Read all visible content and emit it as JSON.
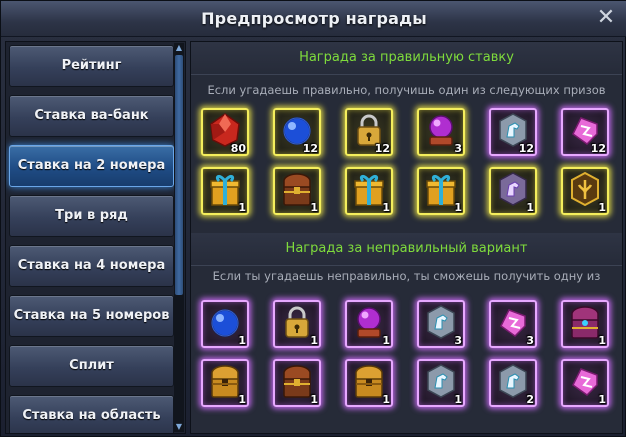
{
  "window": {
    "title": "Предпросмотр награды"
  },
  "sidebar": {
    "tabs": [
      {
        "label": "Рейтинг",
        "active": false
      },
      {
        "label": "Ставка ва-банк",
        "active": false
      },
      {
        "label": "Ставка на 2 номера",
        "active": true
      },
      {
        "label": "Три в ряд",
        "active": false
      },
      {
        "label": "Ставка на 4 номера",
        "active": false
      },
      {
        "label": "Ставка на 5 номеров",
        "active": false
      },
      {
        "label": "Сплит",
        "active": false
      },
      {
        "label": "Ставка на область",
        "active": false
      }
    ]
  },
  "correct": {
    "header": "Награда за правильную ставку",
    "description": "Если угадаешь правильно, получишь один из следующих призов",
    "items": [
      {
        "icon": "red-gem-icon",
        "qty": "80",
        "frame": "gold"
      },
      {
        "icon": "blue-orb-icon",
        "qty": "12",
        "frame": "gold"
      },
      {
        "icon": "padlock-icon",
        "qty": "12",
        "frame": "gold"
      },
      {
        "icon": "crystal-ball-icon",
        "qty": "3",
        "frame": "gold"
      },
      {
        "icon": "horse-token-icon",
        "qty": "12",
        "frame": "purple"
      },
      {
        "icon": "pink-crystal-icon",
        "qty": "12",
        "frame": "purple"
      },
      {
        "icon": "gift-box-icon",
        "qty": "1",
        "frame": "gold"
      },
      {
        "icon": "treasure-chest-icon",
        "qty": "1",
        "frame": "gold"
      },
      {
        "icon": "gift-box-icon",
        "qty": "1",
        "frame": "gold"
      },
      {
        "icon": "gift-box-icon",
        "qty": "1",
        "frame": "gold"
      },
      {
        "icon": "purple-horse-token-icon",
        "qty": "1",
        "frame": "gold"
      },
      {
        "icon": "gold-emblem-icon",
        "qty": "1",
        "frame": "gold"
      }
    ]
  },
  "incorrect": {
    "header": "Награда за неправильный вариант",
    "description": "Если ты угадаешь неправильно, ты сможешь получить одну из",
    "items": [
      {
        "icon": "blue-orb-icon",
        "qty": "1",
        "frame": "purple"
      },
      {
        "icon": "padlock-icon",
        "qty": "1",
        "frame": "purple"
      },
      {
        "icon": "crystal-ball-icon",
        "qty": "1",
        "frame": "purple"
      },
      {
        "icon": "horse-token-icon",
        "qty": "3",
        "frame": "purple"
      },
      {
        "icon": "pink-crystal-icon",
        "qty": "3",
        "frame": "purple"
      },
      {
        "icon": "jeweled-chest-icon",
        "qty": "1",
        "frame": "purple"
      },
      {
        "icon": "golden-chest-icon",
        "qty": "1",
        "frame": "purple"
      },
      {
        "icon": "treasure-chest-icon",
        "qty": "1",
        "frame": "purple"
      },
      {
        "icon": "golden-chest-icon",
        "qty": "1",
        "frame": "purple"
      },
      {
        "icon": "horse-token-icon",
        "qty": "1",
        "frame": "purple"
      },
      {
        "icon": "horse-token-icon",
        "qty": "2",
        "frame": "purple"
      },
      {
        "icon": "pink-crystal-icon",
        "qty": "1",
        "frame": "purple"
      }
    ]
  },
  "colors": {
    "header_text": "#7fdc3c",
    "gold_frame": "#f4ee5c",
    "purple_frame": "#e7a8ff",
    "active_tab": "#1f4c85"
  }
}
